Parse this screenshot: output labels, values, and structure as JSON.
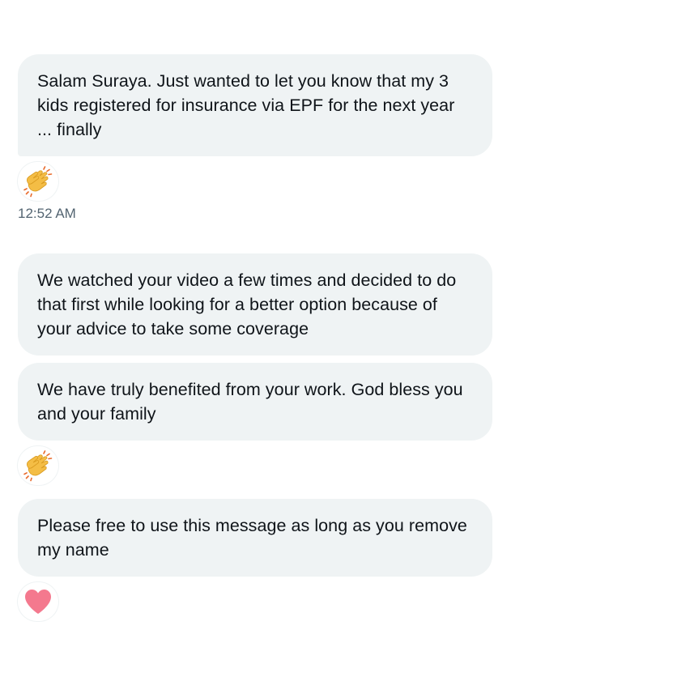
{
  "conversation": {
    "messages": [
      {
        "text": "Salam Suraya. Just wanted to let you know that my 3 kids registered for insurance via EPF for the next year ... finally"
      },
      {
        "text": "We watched your video a few times and decided to do that first while looking for a better option because of your advice to take some coverage"
      },
      {
        "text": "We have truly benefited from your work. God bless you and your family"
      },
      {
        "text": "Please free to use this message as long as you remove my name"
      }
    ],
    "timestamp": "12:52 AM",
    "reactions": [
      {
        "icon": "clapping-hands-icon"
      },
      {
        "icon": "clapping-hands-icon"
      },
      {
        "icon": "heart-icon",
        "color": "#f4798e"
      }
    ]
  },
  "colors": {
    "bubble_background": "#eff3f4",
    "text": "#0f1419",
    "timestamp": "#536471"
  }
}
